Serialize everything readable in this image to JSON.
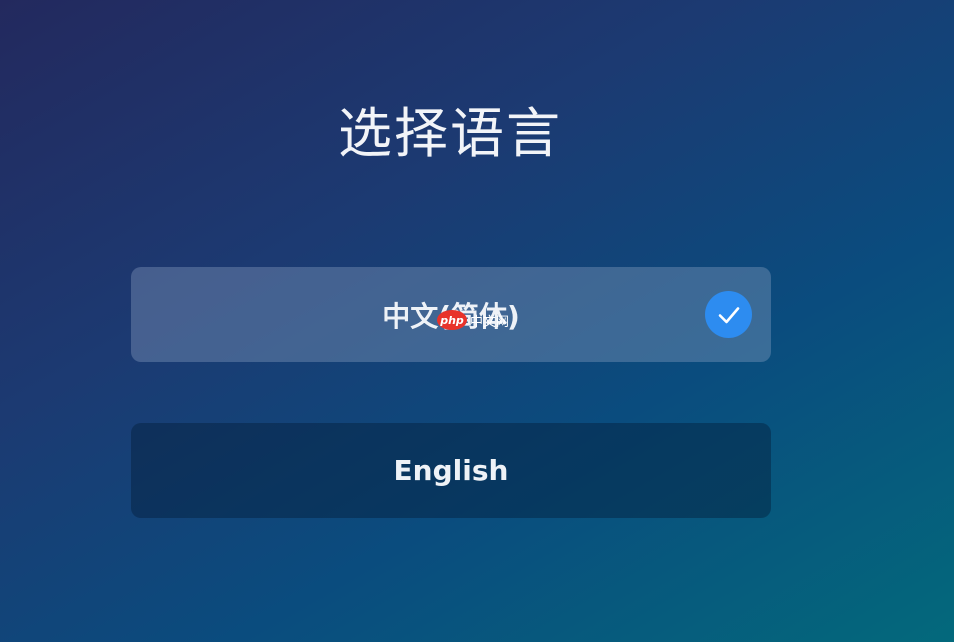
{
  "page": {
    "title": "选择语言"
  },
  "languages": [
    {
      "label": "中文(简体)",
      "selected": true
    },
    {
      "label": "English",
      "selected": false
    }
  ],
  "icons": {
    "selected_check": "check-icon"
  },
  "watermark": {
    "logo_text": "php",
    "site_text": "中文网"
  },
  "colors": {
    "check_badge": "#2d8cf0",
    "watermark_logo": "#e8322a"
  }
}
